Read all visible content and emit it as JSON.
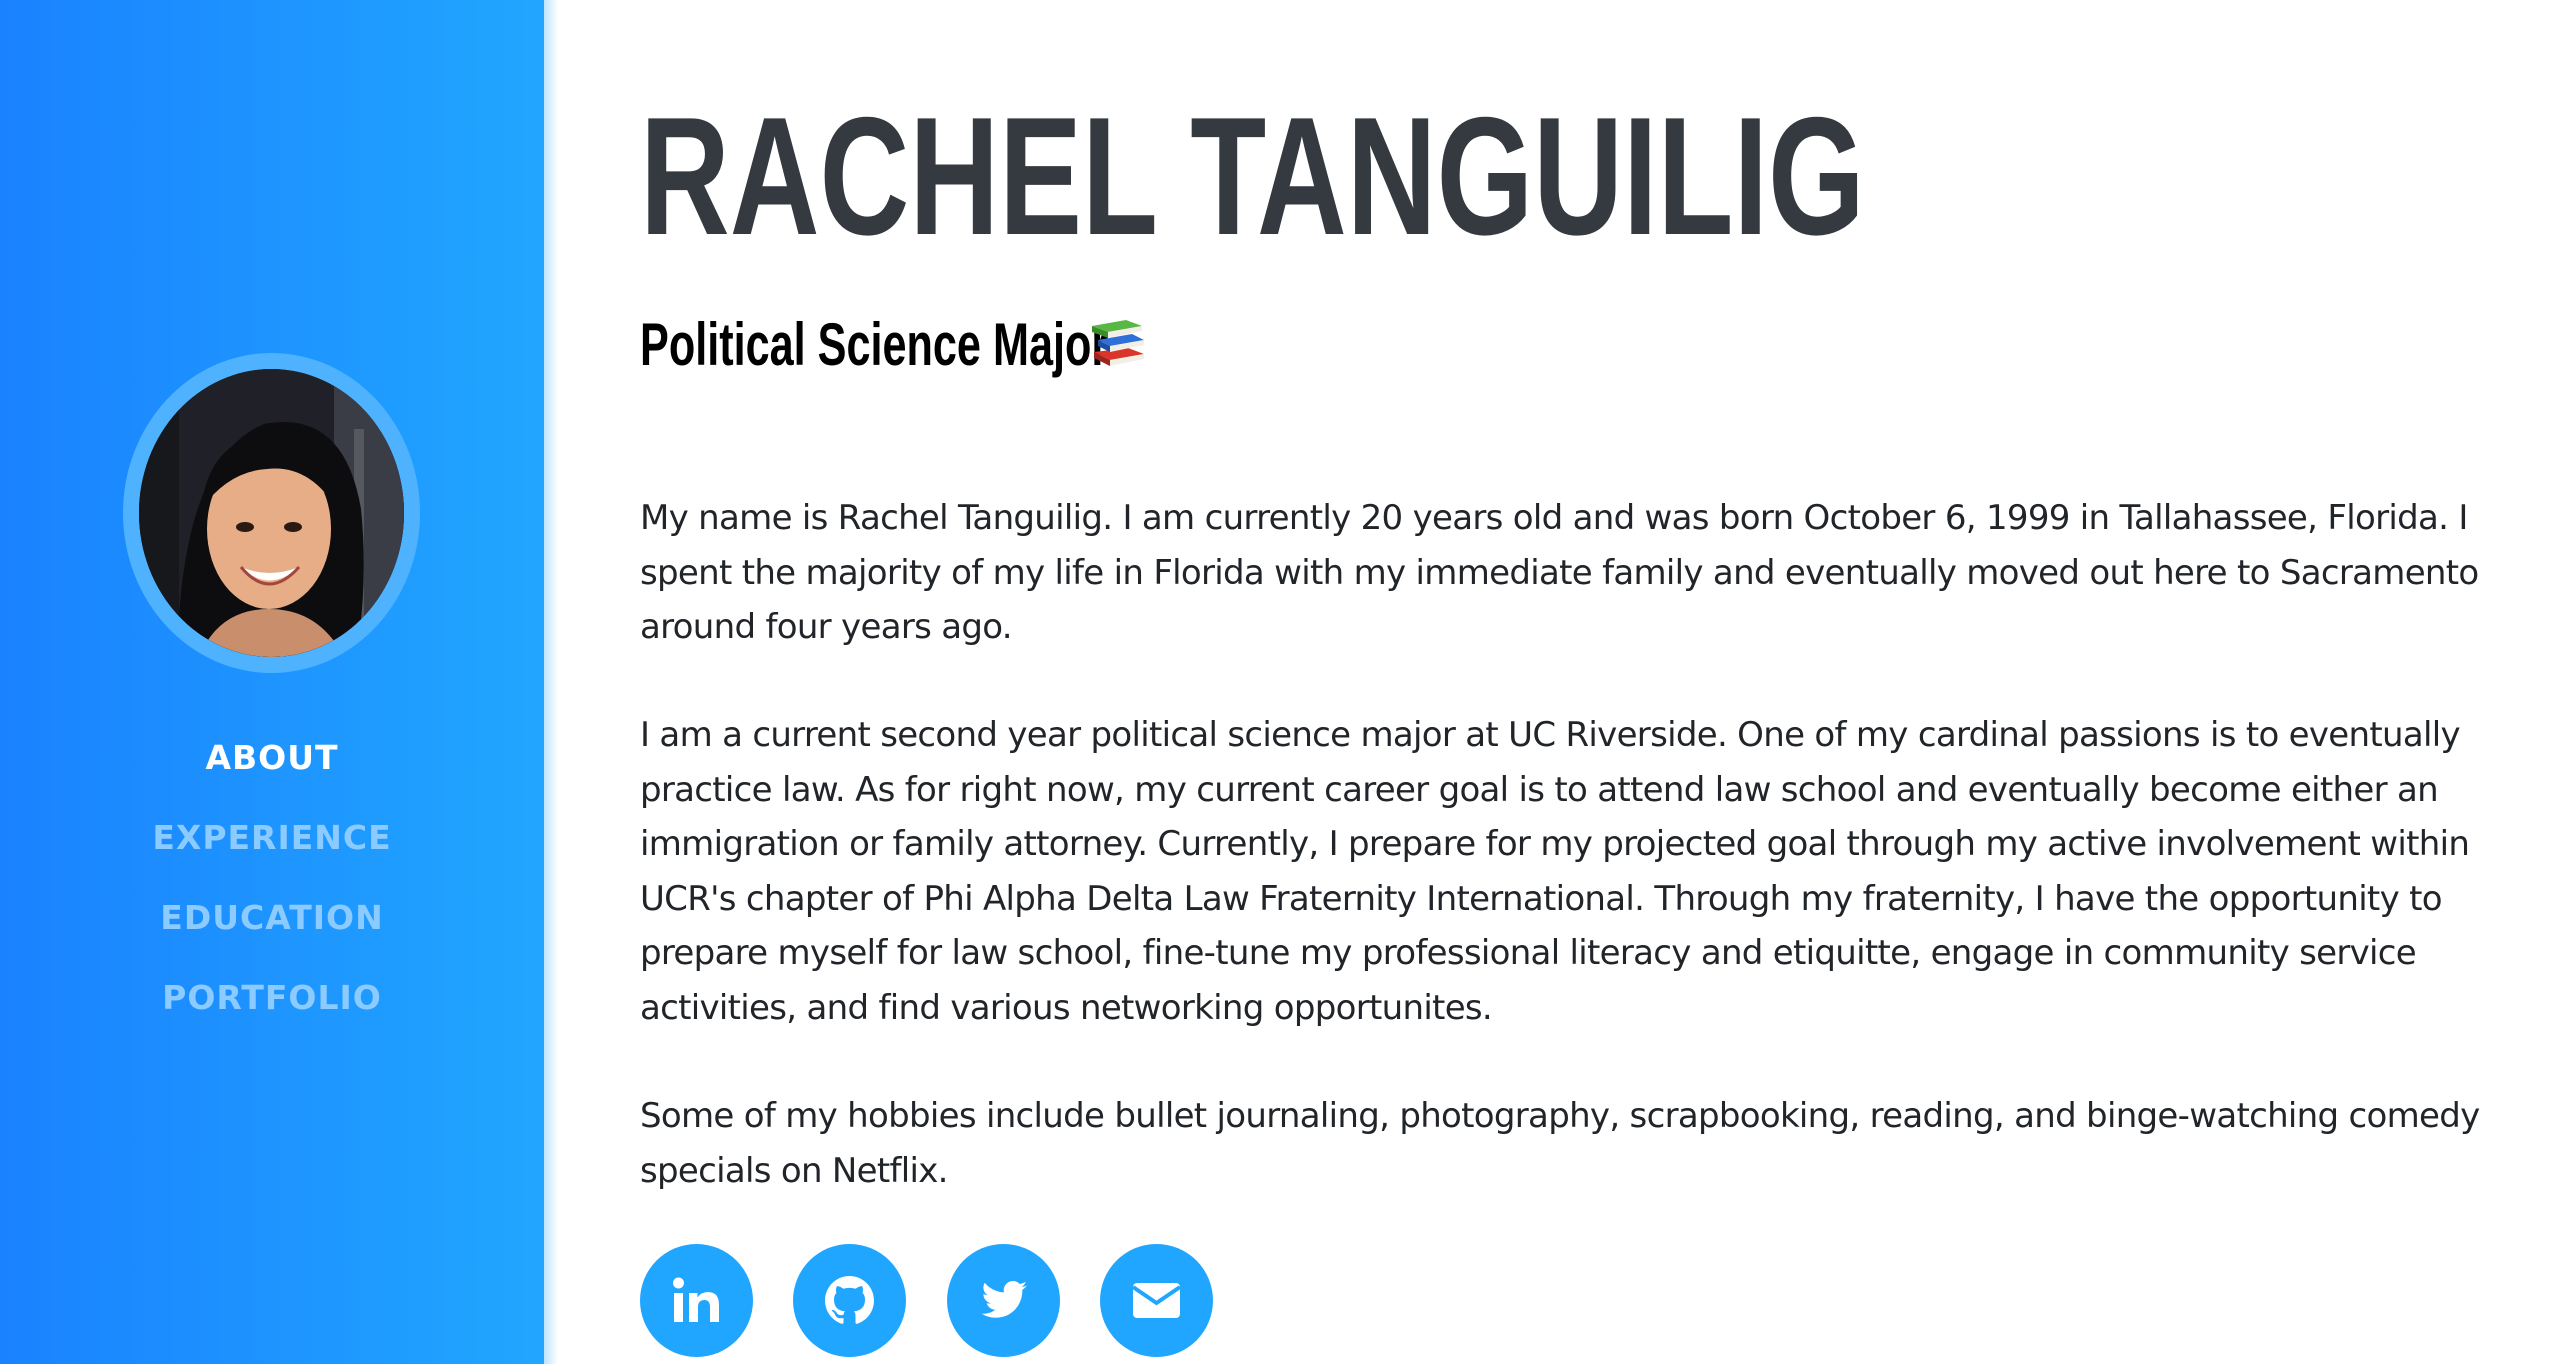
{
  "profile": {
    "name": "RACHEL TANGUILIG",
    "subtitle": "Political Science Major"
  },
  "nav": {
    "items": [
      {
        "label": "ABOUT",
        "active": true
      },
      {
        "label": "EXPERIENCE",
        "active": false
      },
      {
        "label": "EDUCATION",
        "active": false
      },
      {
        "label": "PORTFOLIO",
        "active": false
      }
    ]
  },
  "about": {
    "paragraphs": [
      "My name is Rachel Tanguilig. I am currently 20 years old and was born October 6, 1999 in Tallahassee, Florida. I spent the majority of my life in Florida with my immediate family and eventually moved out here to Sacramento around four years ago.",
      "I am a current second year political science major at UC Riverside. One of my cardinal passions is to eventually practice law. As for right now, my current career goal is to attend law school and eventually become either an immigration or family attorney. Currently, I prepare for my projected goal through my active involvement within UCR's chapter of Phi Alpha Delta Law Fraternity International. Through my fraternity, I have the opportunity to prepare myself for law school, fine-tune my professional literacy and etiquitte, engage in community service activities, and find various networking opportunites.",
      "Some of my hobbies include bullet journaling, photography, scrapbooking, reading, and binge-watching comedy specials on Netflix."
    ]
  },
  "social": {
    "icons": [
      "linkedin-icon",
      "github-icon",
      "twitter-icon",
      "envelope-icon"
    ]
  },
  "colors": {
    "sidebar_start": "#1a82ff",
    "sidebar_end": "#21a6ff",
    "accent": "#21a6ff",
    "nav_inactive": "#8ccbff",
    "heading": "#343a40",
    "body_text": "#212529"
  }
}
